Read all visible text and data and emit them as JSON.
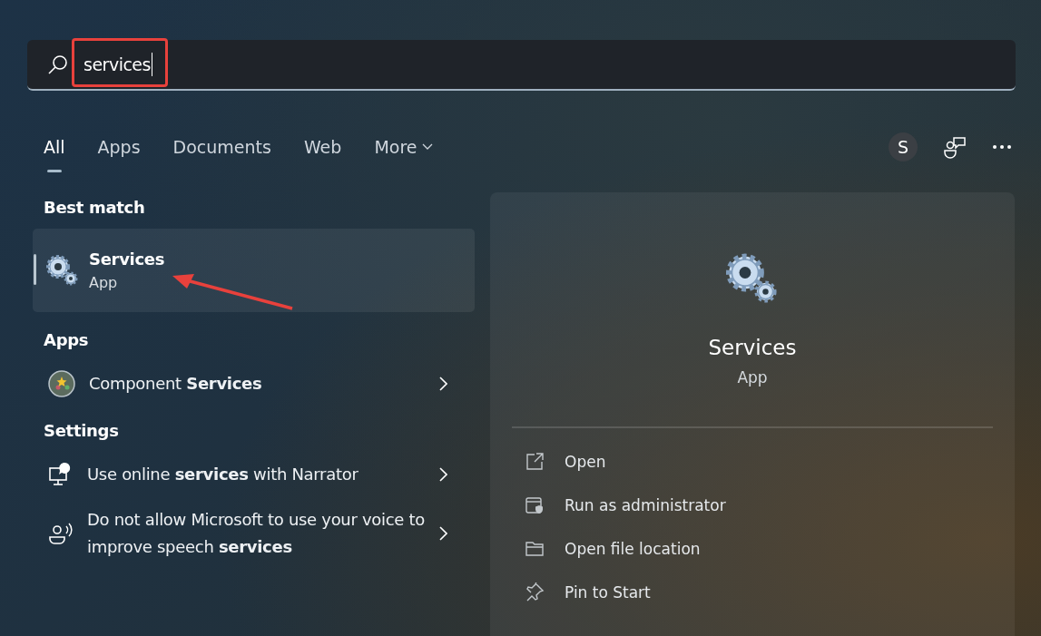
{
  "search": {
    "value": "services"
  },
  "tabs": [
    {
      "label": "All",
      "selected": true,
      "kind": "plain"
    },
    {
      "label": "Apps",
      "selected": false,
      "kind": "plain"
    },
    {
      "label": "Documents",
      "selected": false,
      "kind": "plain"
    },
    {
      "label": "Web",
      "selected": false,
      "kind": "plain"
    },
    {
      "label": "More",
      "selected": false,
      "kind": "menu"
    }
  ],
  "account": {
    "initial": "S"
  },
  "best_match": {
    "heading": "Best match",
    "items": [
      {
        "title": "Services",
        "subtitle": "App",
        "selected": true
      }
    ]
  },
  "apps": {
    "heading": "Apps",
    "items": [
      {
        "label": "Component **Services**",
        "kind": "component"
      }
    ]
  },
  "settings": {
    "heading": "Settings",
    "items": [
      {
        "label": "Use online **services** with Narrator",
        "kind": "narrator"
      },
      {
        "label": "Do not allow Microsoft to use your voice to improve speech **services**",
        "kind": "voice"
      }
    ]
  },
  "detail": {
    "title": "Services",
    "subtitle": "App",
    "actions": [
      {
        "label": "Open",
        "kind": "open"
      },
      {
        "label": "Run as administrator",
        "kind": "admin"
      },
      {
        "label": "Open file location",
        "kind": "folder"
      },
      {
        "label": "Pin to Start",
        "kind": "pin"
      }
    ]
  }
}
